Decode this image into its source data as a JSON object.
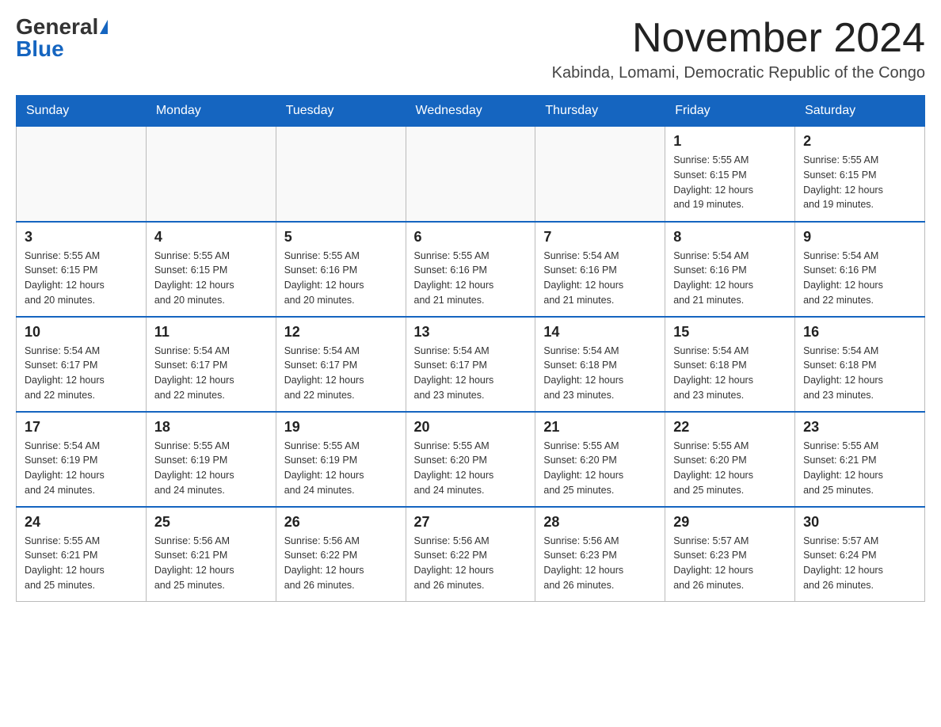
{
  "logo": {
    "general": "General",
    "blue": "Blue"
  },
  "title": "November 2024",
  "location": "Kabinda, Lomami, Democratic Republic of the Congo",
  "days_of_week": [
    "Sunday",
    "Monday",
    "Tuesday",
    "Wednesday",
    "Thursday",
    "Friday",
    "Saturday"
  ],
  "weeks": [
    [
      {
        "day": "",
        "info": ""
      },
      {
        "day": "",
        "info": ""
      },
      {
        "day": "",
        "info": ""
      },
      {
        "day": "",
        "info": ""
      },
      {
        "day": "",
        "info": ""
      },
      {
        "day": "1",
        "info": "Sunrise: 5:55 AM\nSunset: 6:15 PM\nDaylight: 12 hours\nand 19 minutes."
      },
      {
        "day": "2",
        "info": "Sunrise: 5:55 AM\nSunset: 6:15 PM\nDaylight: 12 hours\nand 19 minutes."
      }
    ],
    [
      {
        "day": "3",
        "info": "Sunrise: 5:55 AM\nSunset: 6:15 PM\nDaylight: 12 hours\nand 20 minutes."
      },
      {
        "day": "4",
        "info": "Sunrise: 5:55 AM\nSunset: 6:15 PM\nDaylight: 12 hours\nand 20 minutes."
      },
      {
        "day": "5",
        "info": "Sunrise: 5:55 AM\nSunset: 6:16 PM\nDaylight: 12 hours\nand 20 minutes."
      },
      {
        "day": "6",
        "info": "Sunrise: 5:55 AM\nSunset: 6:16 PM\nDaylight: 12 hours\nand 21 minutes."
      },
      {
        "day": "7",
        "info": "Sunrise: 5:54 AM\nSunset: 6:16 PM\nDaylight: 12 hours\nand 21 minutes."
      },
      {
        "day": "8",
        "info": "Sunrise: 5:54 AM\nSunset: 6:16 PM\nDaylight: 12 hours\nand 21 minutes."
      },
      {
        "day": "9",
        "info": "Sunrise: 5:54 AM\nSunset: 6:16 PM\nDaylight: 12 hours\nand 22 minutes."
      }
    ],
    [
      {
        "day": "10",
        "info": "Sunrise: 5:54 AM\nSunset: 6:17 PM\nDaylight: 12 hours\nand 22 minutes."
      },
      {
        "day": "11",
        "info": "Sunrise: 5:54 AM\nSunset: 6:17 PM\nDaylight: 12 hours\nand 22 minutes."
      },
      {
        "day": "12",
        "info": "Sunrise: 5:54 AM\nSunset: 6:17 PM\nDaylight: 12 hours\nand 22 minutes."
      },
      {
        "day": "13",
        "info": "Sunrise: 5:54 AM\nSunset: 6:17 PM\nDaylight: 12 hours\nand 23 minutes."
      },
      {
        "day": "14",
        "info": "Sunrise: 5:54 AM\nSunset: 6:18 PM\nDaylight: 12 hours\nand 23 minutes."
      },
      {
        "day": "15",
        "info": "Sunrise: 5:54 AM\nSunset: 6:18 PM\nDaylight: 12 hours\nand 23 minutes."
      },
      {
        "day": "16",
        "info": "Sunrise: 5:54 AM\nSunset: 6:18 PM\nDaylight: 12 hours\nand 23 minutes."
      }
    ],
    [
      {
        "day": "17",
        "info": "Sunrise: 5:54 AM\nSunset: 6:19 PM\nDaylight: 12 hours\nand 24 minutes."
      },
      {
        "day": "18",
        "info": "Sunrise: 5:55 AM\nSunset: 6:19 PM\nDaylight: 12 hours\nand 24 minutes."
      },
      {
        "day": "19",
        "info": "Sunrise: 5:55 AM\nSunset: 6:19 PM\nDaylight: 12 hours\nand 24 minutes."
      },
      {
        "day": "20",
        "info": "Sunrise: 5:55 AM\nSunset: 6:20 PM\nDaylight: 12 hours\nand 24 minutes."
      },
      {
        "day": "21",
        "info": "Sunrise: 5:55 AM\nSunset: 6:20 PM\nDaylight: 12 hours\nand 25 minutes."
      },
      {
        "day": "22",
        "info": "Sunrise: 5:55 AM\nSunset: 6:20 PM\nDaylight: 12 hours\nand 25 minutes."
      },
      {
        "day": "23",
        "info": "Sunrise: 5:55 AM\nSunset: 6:21 PM\nDaylight: 12 hours\nand 25 minutes."
      }
    ],
    [
      {
        "day": "24",
        "info": "Sunrise: 5:55 AM\nSunset: 6:21 PM\nDaylight: 12 hours\nand 25 minutes."
      },
      {
        "day": "25",
        "info": "Sunrise: 5:56 AM\nSunset: 6:21 PM\nDaylight: 12 hours\nand 25 minutes."
      },
      {
        "day": "26",
        "info": "Sunrise: 5:56 AM\nSunset: 6:22 PM\nDaylight: 12 hours\nand 26 minutes."
      },
      {
        "day": "27",
        "info": "Sunrise: 5:56 AM\nSunset: 6:22 PM\nDaylight: 12 hours\nand 26 minutes."
      },
      {
        "day": "28",
        "info": "Sunrise: 5:56 AM\nSunset: 6:23 PM\nDaylight: 12 hours\nand 26 minutes."
      },
      {
        "day": "29",
        "info": "Sunrise: 5:57 AM\nSunset: 6:23 PM\nDaylight: 12 hours\nand 26 minutes."
      },
      {
        "day": "30",
        "info": "Sunrise: 5:57 AM\nSunset: 6:24 PM\nDaylight: 12 hours\nand 26 minutes."
      }
    ]
  ]
}
